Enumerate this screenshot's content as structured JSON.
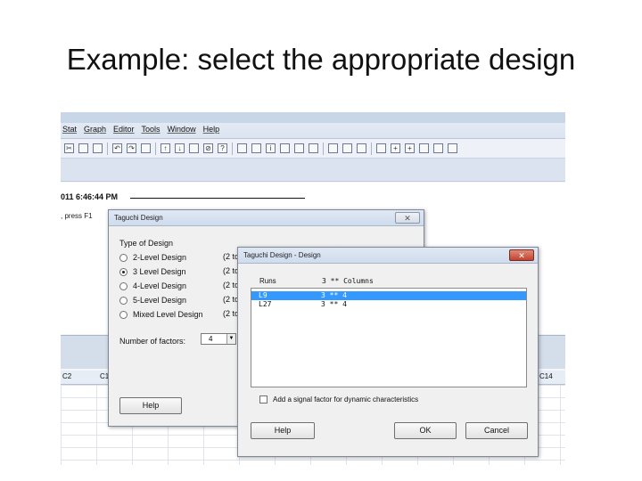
{
  "slide": {
    "title": "Example: select the appropriate design"
  },
  "app": {
    "menus": [
      "Stat",
      "Graph",
      "Editor",
      "Tools",
      "Window",
      "Help"
    ],
    "session": {
      "timestamp": "011 6:46:44 PM",
      "hint": "press F1"
    },
    "columns": [
      "C2",
      "C1",
      "C14"
    ]
  },
  "dialog1": {
    "title": "Taguchi Design",
    "close_icon": "x-icon",
    "type_label": "Type of Design",
    "options": [
      {
        "label": "2-Level Design",
        "range": "(2 to",
        "selected": false
      },
      {
        "label": "3 Level Design",
        "range": "(2 to",
        "selected": true
      },
      {
        "label": "4-Level Design",
        "range": "(2 to",
        "selected": false
      },
      {
        "label": "5-Level Design",
        "range": "(2 to",
        "selected": false
      },
      {
        "label": "Mixed Level Design",
        "range": "(2 to",
        "selected": false
      }
    ],
    "factors_label": "Number of factors:",
    "factors_value": "4",
    "help_label": "Help"
  },
  "dialog2": {
    "title": "Taguchi Design - Design",
    "close_icon": "x-icon",
    "runs_header": "Runs",
    "columns_header": "3 ** Columns",
    "rows": [
      {
        "runs": "L9",
        "cols": "3 ** 4",
        "selected": true
      },
      {
        "runs": "L27",
        "cols": "3 ** 4",
        "selected": false
      }
    ],
    "checkbox_label": "Add a signal factor for dynamic characteristics",
    "help_label": "Help",
    "ok_label": "OK",
    "cancel_label": "Cancel"
  }
}
